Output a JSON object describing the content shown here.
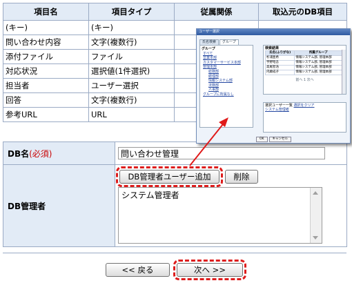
{
  "items_table": {
    "headers": [
      "項目名",
      "項目タイプ",
      "従属関係",
      "取込元のDB項目"
    ],
    "rows": [
      [
        "(キー)",
        "(キー)"
      ],
      [
        "問い合わせ内容",
        "文字(複数行)"
      ],
      [
        "添付ファイル",
        "ファイル"
      ],
      [
        "対応状況",
        "選択値(1件選択)"
      ],
      [
        "担当者",
        "ユーザー選択"
      ],
      [
        "回答",
        "文字(複数行)"
      ],
      [
        "参考URL",
        "URL"
      ]
    ]
  },
  "popup": {
    "title": "ユーザー選択",
    "tabs": [
      "氏名検索",
      "グループ"
    ],
    "group_heading": "グループ",
    "group_items": [
      "すべて",
      "営業本部",
      "カスタマーサービス本部",
      "管理本部",
      "総務部",
      "経理部",
      "情報システム部",
      "法務部",
      "人事部",
      "グループに所属なし"
    ],
    "result_heading": "検索結果",
    "result_columns": [
      "氏名(ふりがな)",
      "所属グループ"
    ],
    "result_rows": [
      [
        "杉浦亜希",
        "情報システム部, 管理本部"
      ],
      [
        "宇野昭吾",
        "情報システム部, 管理本部"
      ],
      [
        "高尾智浩",
        "情報システム部, 管理本部"
      ],
      [
        "内藤成子",
        "情報システム部, 管理本部"
      ]
    ],
    "pager": "前へ 1 次へ",
    "selected_label": "選択ユーザー一覧",
    "selected_link": "選択をクリア",
    "selected_user": "システム管理者",
    "ok_label": "OK",
    "cancel_label": "キャンセル"
  },
  "form": {
    "dbname_label": "DB名",
    "required_mark": "(必須)",
    "dbname_value": "問い合わせ管理",
    "admin_label": "DB管理者",
    "add_admin_button": "DB管理者ユーザー追加",
    "delete_button": "削除",
    "admin_list": [
      "システム管理者"
    ]
  },
  "footer": {
    "back_button": "<< 戻る",
    "next_button": "次へ >>"
  },
  "colors": {
    "header_bg": "#e2ebf6",
    "border": "#9aaac4",
    "highlight": "#dd1c1c"
  }
}
